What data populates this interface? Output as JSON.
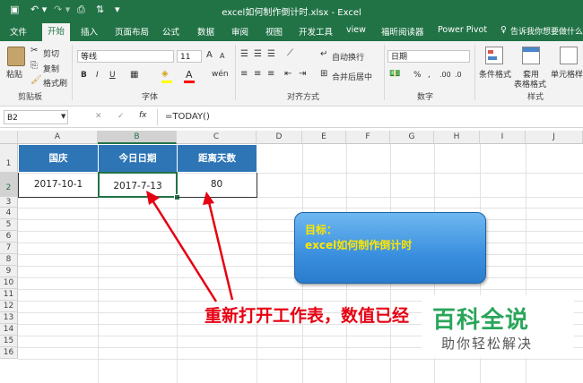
{
  "window": {
    "title": "excel如何制作倒计时.xlsx  -  Excel"
  },
  "tabs": [
    "文件",
    "开始",
    "插入",
    "页面布局",
    "公式",
    "数据",
    "审阅",
    "视图",
    "开发工具",
    "view",
    "福昕阅读器",
    "Power Pivot"
  ],
  "active_tab": "开始",
  "tell_me": "告诉我你想要做什么",
  "ribbon": {
    "clipboard": {
      "paste": "粘贴",
      "cut": "剪切",
      "copy": "复制",
      "format_painter": "格式刷",
      "group": "剪贴板"
    },
    "font": {
      "name": "等线",
      "size": "11",
      "group": "字体",
      "bold": "B",
      "italic": "I",
      "underline": "U",
      "grow": "A",
      "shrink": "A",
      "color_letter": "A"
    },
    "alignment": {
      "wrap": "自动换行",
      "merge": "合并后居中",
      "group": "对齐方式"
    },
    "number": {
      "format": "日期",
      "percent": "%",
      "comma": ",",
      "group": "数字"
    },
    "styles": {
      "cond": "条件格式",
      "table1": "套用",
      "table2": "表格格式",
      "cell": "单元格样",
      "group": "样式"
    }
  },
  "formula_bar": {
    "name_box": "B2",
    "cancel": "✕",
    "enter": "✓",
    "fx": "fx",
    "formula": "=TODAY()"
  },
  "columns": [
    "A",
    "B",
    "C",
    "D",
    "E",
    "F",
    "G",
    "H",
    "I",
    "J"
  ],
  "rows": [
    "1",
    "2",
    "3",
    "4",
    "5",
    "6",
    "7",
    "8",
    "9",
    "10",
    "11",
    "12",
    "13",
    "14",
    "15",
    "16"
  ],
  "table": {
    "headers": [
      "国庆",
      "今日日期",
      "距离天数"
    ],
    "values": [
      "2017-10-1",
      "2017-7-13",
      "80"
    ]
  },
  "callout": {
    "line1": "目标：",
    "line2": "excel如何制作倒计时"
  },
  "annotation": "重新打开工作表，数值已经",
  "watermark": {
    "main": "百科全说",
    "sub": "助你轻松解决"
  },
  "colors": {
    "excel_green": "#217346",
    "header_fill": "#2e75b6",
    "annotation_red": "#e60012"
  }
}
